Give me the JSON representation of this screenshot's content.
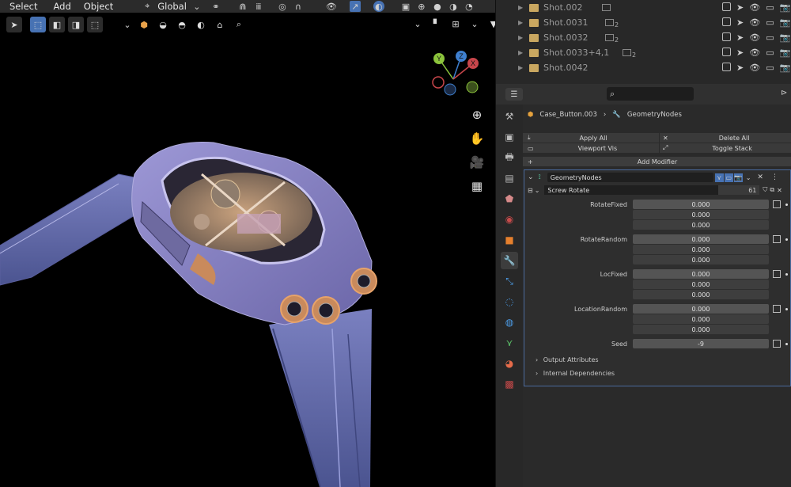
{
  "viewport": {
    "menu": [
      "Select",
      "Add",
      "Object"
    ],
    "transform_orientation": "Global",
    "gizmo_axes": {
      "y": "Y",
      "z": "Z",
      "x": "X"
    }
  },
  "outliner": {
    "rows": [
      {
        "name": "Shot.002",
        "badge": ""
      },
      {
        "name": "Shot.0031",
        "badge": "2"
      },
      {
        "name": "Shot.0032",
        "badge": "2"
      },
      {
        "name": "Shot.0033+4,1",
        "badge": "2"
      },
      {
        "name": "Shot.0042",
        "badge": ""
      }
    ]
  },
  "properties": {
    "search_placeholder": "",
    "breadcrumb": {
      "object": "Case_Button.003",
      "modifier": "GeometryNodes"
    },
    "buttons": {
      "apply_all": "Apply All",
      "delete_all": "Delete All",
      "viewport_vis": "Viewport Vis",
      "toggle_stack": "Toggle Stack",
      "add_modifier": "Add Modifier"
    },
    "modifier": {
      "name": "GeometryNodes",
      "node_group": "Screw Rotate",
      "users": "61",
      "fields": [
        {
          "label": "RotateFixed",
          "values": [
            "0.000",
            "0.000",
            "0.000"
          ]
        },
        {
          "label": "RotateRandom",
          "values": [
            "0.000",
            "0.000",
            "0.000"
          ]
        },
        {
          "label": "LocFixed",
          "values": [
            "0.000",
            "0.000",
            "0.000"
          ]
        },
        {
          "label": "LocationRandom",
          "values": [
            "0.000",
            "0.000",
            "0.000"
          ]
        }
      ],
      "seed_label": "Seed",
      "seed_value": "-9",
      "output_attributes": "Output Attributes",
      "internal_dependencies": "Internal Dependencies"
    }
  },
  "colors": {
    "accent": "#4772b3",
    "watch_body": "#8a86c8",
    "watch_strap": "#6f78b8",
    "copper": "#c98a5c",
    "axis_x": "#c8464b",
    "axis_y": "#8cc43c",
    "axis_z": "#3e7fce"
  }
}
